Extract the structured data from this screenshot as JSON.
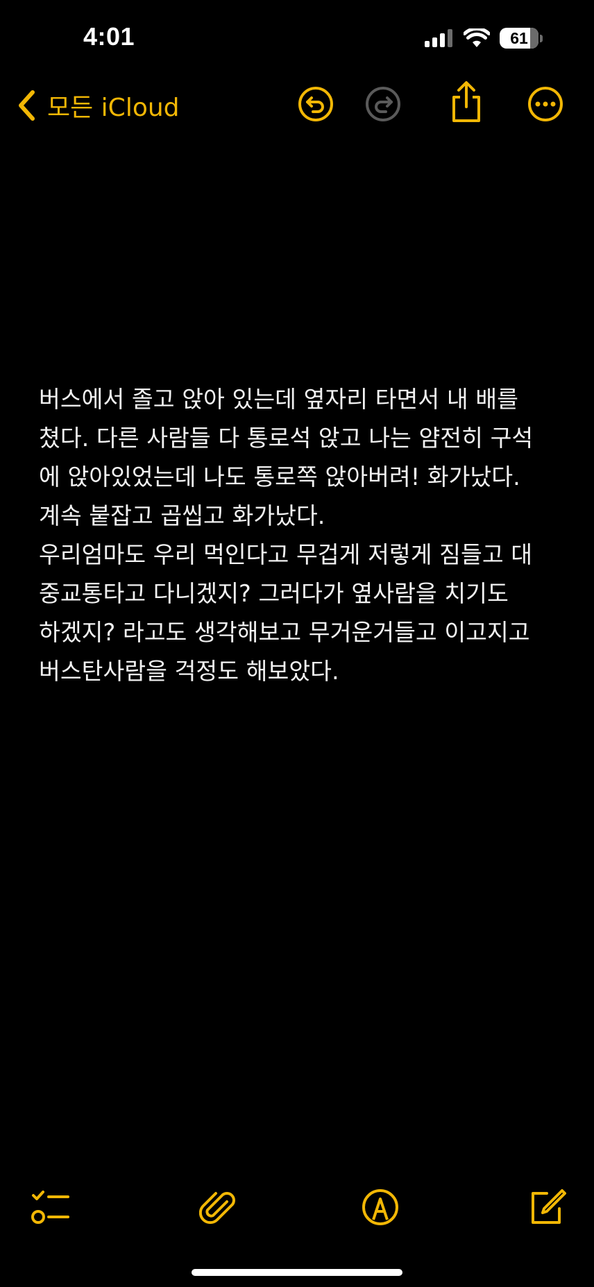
{
  "status_bar": {
    "time": "4:01",
    "battery_level": "61",
    "signal_icon": "cellular-signal-icon",
    "wifi_icon": "wifi-icon"
  },
  "nav": {
    "back_label": "모든 iCloud",
    "back_icon": "chevron-left-icon",
    "undo_icon": "undo-icon",
    "redo_icon": "redo-icon",
    "share_icon": "share-icon",
    "more_icon": "ellipsis-circle-icon"
  },
  "note": {
    "lines": [
      "버스에서 졸고 앉아 있는데 옆자리 타면서 내 배를",
      "쳤다. 다른 사람들 다 통로석 앉고 나는 얌전히 구석",
      "에 앉아있었는데 나도 통로쪽 앉아버려! 화가났다.",
      "계속 붙잡고 곱씹고 화가났다.",
      "우리엄마도 우리 먹인다고 무겁게 저렇게 짐들고 대",
      "중교통타고 다니겠지? 그러다가 옆사람을 치기도",
      "하겠지? 라고도 생각해보고 무거운거들고 이고지고",
      "버스탄사람을 걱정도 해보았다."
    ]
  },
  "toolbar": {
    "checklist_icon": "checklist-icon",
    "attachment_icon": "paperclip-icon",
    "markup_icon": "markup-pen-icon",
    "compose_icon": "compose-icon"
  },
  "colors": {
    "accent": "#f2b705",
    "background": "#000000",
    "text": "#f2f2f2",
    "disabled": "#5a5a5a"
  }
}
